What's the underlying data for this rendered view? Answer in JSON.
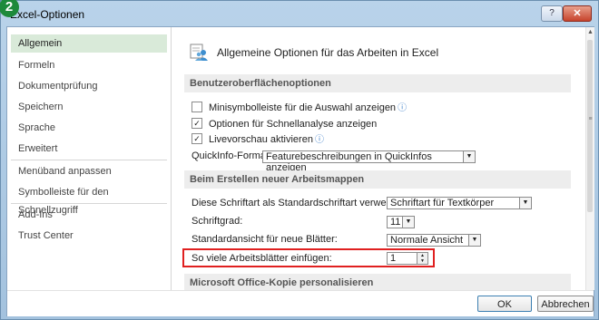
{
  "step_badge": "2",
  "window": {
    "title": "Excel-Optionen",
    "help_glyph": "?",
    "close_glyph": "✕"
  },
  "sidebar": {
    "items": [
      {
        "label": "Allgemein",
        "selected": true
      },
      {
        "label": "Formeln"
      },
      {
        "label": "Dokumentprüfung"
      },
      {
        "label": "Speichern"
      },
      {
        "label": "Sprache"
      },
      {
        "label": "Erweitert"
      },
      {
        "label": "Menüband anpassen"
      },
      {
        "label": "Symbolleiste für den Schnellzugriff"
      },
      {
        "label": "Add-Ins"
      },
      {
        "label": "Trust Center"
      }
    ]
  },
  "main": {
    "header": "Allgemeine Optionen für das Arbeiten in Excel",
    "section_ui": {
      "title": "Benutzeroberflächenoptionen",
      "minitoolbar": {
        "label": "Minisymbolleiste für die Auswahl anzeigen",
        "checked": false
      },
      "quickanalysis": {
        "label": "Optionen für Schnellanalyse anzeigen",
        "checked": true
      },
      "livepreview": {
        "label": "Livevorschau aktivieren",
        "checked": true
      },
      "quickinfo_label": "QuickInfo-Format:",
      "quickinfo_value": "Featurebeschreibungen in QuickInfos anzeigen"
    },
    "section_new": {
      "title": "Beim Erstellen neuer Arbeitsmappen",
      "font_label": "Diese Schriftart als Standardschriftart verwenden:",
      "font_value": "Schriftart für Textkörper",
      "size_label": "Schriftgrad:",
      "size_value": "11",
      "view_label": "Standardansicht für neue Blätter:",
      "view_value": "Normale Ansicht",
      "sheets_label": "So viele Arbeitsblätter einfügen:",
      "sheets_value": "1"
    },
    "section_office": {
      "title": "Microsoft Office-Kopie personalisieren"
    }
  },
  "footer": {
    "ok": "OK",
    "cancel": "Abbrechen"
  },
  "colors": {
    "highlight": "#e02020",
    "sidebar_selected": "#d9ead9",
    "badge": "#1d8a3b",
    "info": "#3a7dc9"
  },
  "icons": {
    "info": "info-icon",
    "header": "options-people-icon",
    "check": "✓",
    "dropdown": "▼",
    "spin_up": "▲",
    "spin_down": "▼",
    "scroll_up": "▲",
    "grip": "≡"
  }
}
